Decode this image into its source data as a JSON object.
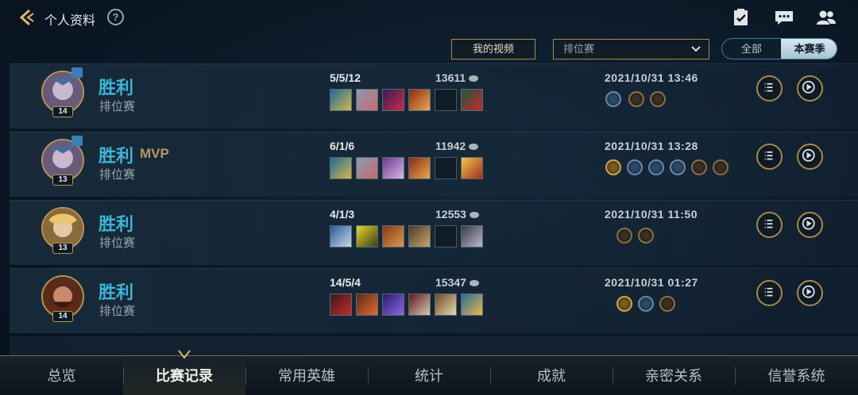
{
  "header": {
    "title": "个人资料",
    "help": "?"
  },
  "filters": {
    "video_button": "我的视频",
    "mode_select": "排位赛",
    "season_all": "全部",
    "season_current": "本赛季"
  },
  "matches": [
    {
      "result": "胜利",
      "mvp": "",
      "mode": "排位赛",
      "level": "14",
      "kda": "5/5/12",
      "score": "13611",
      "date": "2021/10/31 13:46"
    },
    {
      "result": "胜利",
      "mvp": "MVP",
      "mode": "排位赛",
      "level": "13",
      "kda": "6/1/6",
      "score": "11942",
      "date": "2021/10/31 13:28"
    },
    {
      "result": "胜利",
      "mvp": "",
      "mode": "排位赛",
      "level": "13",
      "kda": "4/1/3",
      "score": "12553",
      "date": "2021/10/31 11:50"
    },
    {
      "result": "胜利",
      "mvp": "",
      "mode": "排位赛",
      "level": "14",
      "kda": "14/5/4",
      "score": "15347",
      "date": "2021/10/31 01:27"
    }
  ],
  "nav": {
    "tabs": [
      "总览",
      "比赛记录",
      "常用英雄",
      "统计",
      "成就",
      "亲密关系",
      "信誉系统"
    ],
    "active": "比赛记录"
  },
  "colors": {
    "win": "#3cb5d8",
    "gold": "#b89550",
    "mvp": "#b89a5a"
  }
}
